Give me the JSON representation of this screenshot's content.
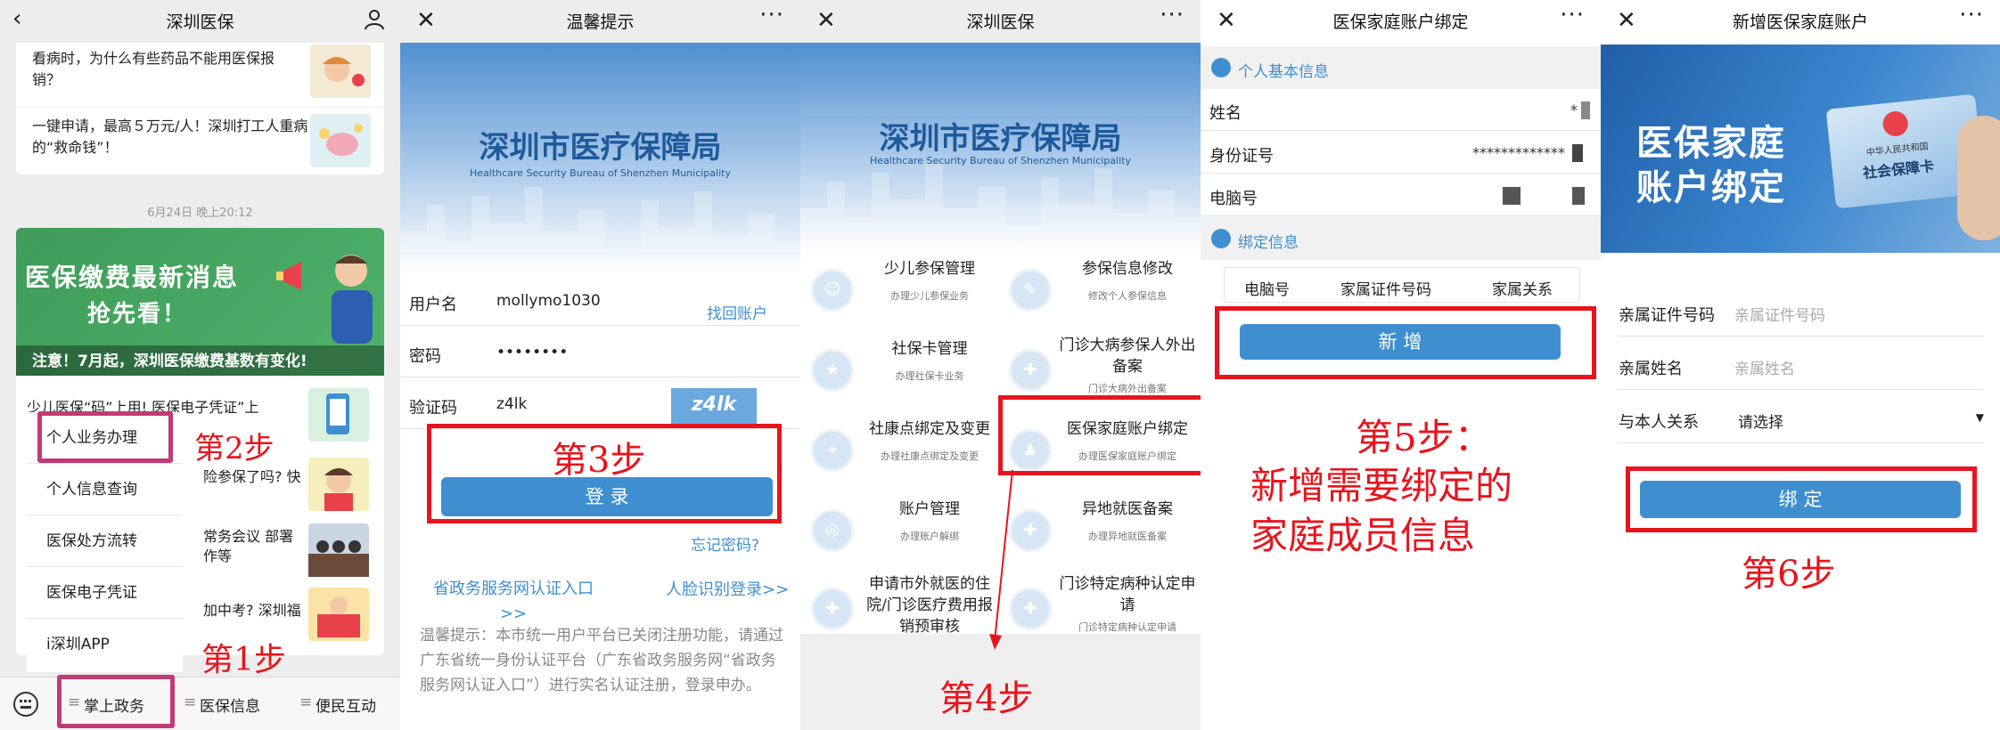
{
  "panel1": {
    "title": "深圳医保",
    "articles": [
      {
        "text": "看病时，为什么有些药品不能用医保报销？"
      },
      {
        "text": "一键申请，最高５万元/人！深圳打工人重病的“救命钱”！"
      }
    ],
    "timestamp": "6月24日 晚上20:12",
    "banner": {
      "line1": "医保缴费最新消息",
      "line2": "抢先看！",
      "notice": "注意！7月起，深圳医保缴费基数有变化!"
    },
    "list": [
      {
        "text": "少儿医保“码”上用! 医保电子凭证”上"
      },
      {
        "text": "险参保了吗? 快"
      },
      {
        "text": "常务会议 部署 作等"
      },
      {
        "text": "加中考? 深圳福"
      }
    ],
    "menu": [
      "个人业务办理",
      "个人信息查询",
      "医保处方流转",
      "医保电子凭证",
      "i深圳APP"
    ],
    "tabs": [
      "掌上政务",
      "医保信息",
      "便民互动"
    ],
    "step1": "第1步",
    "step2": "第2步"
  },
  "panel2": {
    "title": "温馨提示",
    "org_cn": "深圳市医疗保障局",
    "org_en": "Healthcare Security Bureau of Shenzhen Municipality",
    "username_label": "用户名",
    "username_value": "mollymo1030",
    "find_account": "找回账户",
    "password_label": "密码",
    "password_value": "••••••••",
    "captcha_label": "验证码",
    "captcha_value": "z4lk",
    "captcha_image": "z4lk",
    "login_button": "登 录",
    "forgot": "忘记密码?",
    "gov_link": "省政务服务网认证入口>>",
    "face_link": "人脸识别登录>>",
    "tip": "温馨提示：本市统一用户平台已关闭注册功能，请通过广东省统一身份认证平台（广东省政务服务网“省政务服务网认证入口”）进行实名认证注册，登录申办。",
    "step3": "第3步"
  },
  "panel3": {
    "title": "深圳医保",
    "org_cn": "深圳市医疗保障局",
    "org_en": "Healthcare Security Bureau of Shenzhen Municipality",
    "services": [
      {
        "name": "少儿参保管理",
        "desc": "办理少儿参保业务",
        "icon": "child-icon"
      },
      {
        "name": "参保信息修改",
        "desc": "修改个人参保信息",
        "icon": "edit-icon"
      },
      {
        "name": "社保卡管理",
        "desc": "办理社保卡业务",
        "icon": "card-icon"
      },
      {
        "name": "门诊大病参保人外出备案",
        "desc": "门诊大病外出备案",
        "icon": "case-icon"
      },
      {
        "name": "社康点绑定及变更",
        "desc": "办理社康点绑定及变更",
        "icon": "location-icon"
      },
      {
        "name": "医保家庭账户绑定",
        "desc": "办理医保家庭账户绑定",
        "icon": "family-icon"
      },
      {
        "name": "账户管理",
        "desc": "办理账户解绑",
        "icon": "account-icon"
      },
      {
        "name": "异地就医备案",
        "desc": "办理异地就医备案",
        "icon": "case-icon"
      },
      {
        "name": "申请市外就医的住院/门诊医疗费用报销预审核",
        "desc": "",
        "icon": "medkit-icon"
      },
      {
        "name": "门诊特定病种认定申请",
        "desc": "门诊特定病种认定申请",
        "icon": "medkit-icon"
      }
    ],
    "step4": "第4步"
  },
  "panel4": {
    "title": "医保家庭账户绑定",
    "section1": "个人基本信息",
    "name_label": "姓名",
    "name_value": "*",
    "id_label": "身份证号",
    "id_value": "*************",
    "pc_label": "电脑号",
    "section2": "绑定信息",
    "columns": [
      "电脑号",
      "家属证件号码",
      "家属关系"
    ],
    "add_button": "新 增",
    "step5_line1": "第5步：",
    "step5_line2": "新增需要绑定的",
    "step5_line3": "家庭成员信息"
  },
  "panel5": {
    "title": "新增医保家庭账户",
    "banner_line1": "医保家庭",
    "banner_line2": "账户绑定",
    "card_text": "社会保障卡",
    "card_header": "中华人民共和国",
    "fields": [
      {
        "label": "亲属证件号码",
        "placeholder": "亲属证件号码"
      },
      {
        "label": "亲属姓名",
        "placeholder": "亲属姓名"
      },
      {
        "label": "与本人关系",
        "placeholder": "请选择"
      }
    ],
    "bind_button": "绑 定",
    "step6": "第6步"
  }
}
